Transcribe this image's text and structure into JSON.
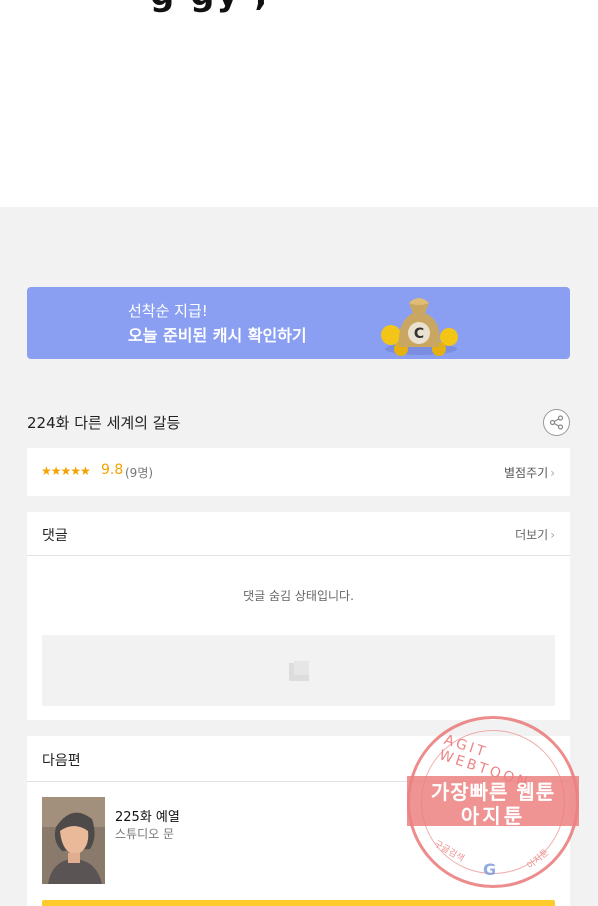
{
  "top_cut_text": "g  gy ,",
  "banner": {
    "line1": "선착순 지급!",
    "line2": "오늘 준비된 캐시 확인하기",
    "coin_letter": "C"
  },
  "episode": {
    "title": "224화 다른 세계의 갈등",
    "share_icon": "share-icon"
  },
  "rating": {
    "stars": "★★★★★",
    "score": "9.8",
    "count": "(9명)",
    "rate_label": "별점주기",
    "chevron": "›"
  },
  "comments": {
    "title": "댓글",
    "more_label": "더보기",
    "chevron": "›",
    "hidden_message": "댓글 숨김 상태입니다."
  },
  "next": {
    "title": "다음편",
    "episode": "225화 예열",
    "studio": "스튜디오 문"
  },
  "watermark": {
    "ring_text": "AGIT WEBTOON",
    "line1": "가장빠른 웹툰",
    "line2": "아지툰",
    "bottom_left": "구글검색",
    "bottom_right": "아지툰",
    "google_letter": "G"
  },
  "colors": {
    "banner_bg": "#8a9ff2",
    "star": "#f5a200",
    "next_button": "#ffcb2b",
    "watermark": "#ec8080"
  }
}
